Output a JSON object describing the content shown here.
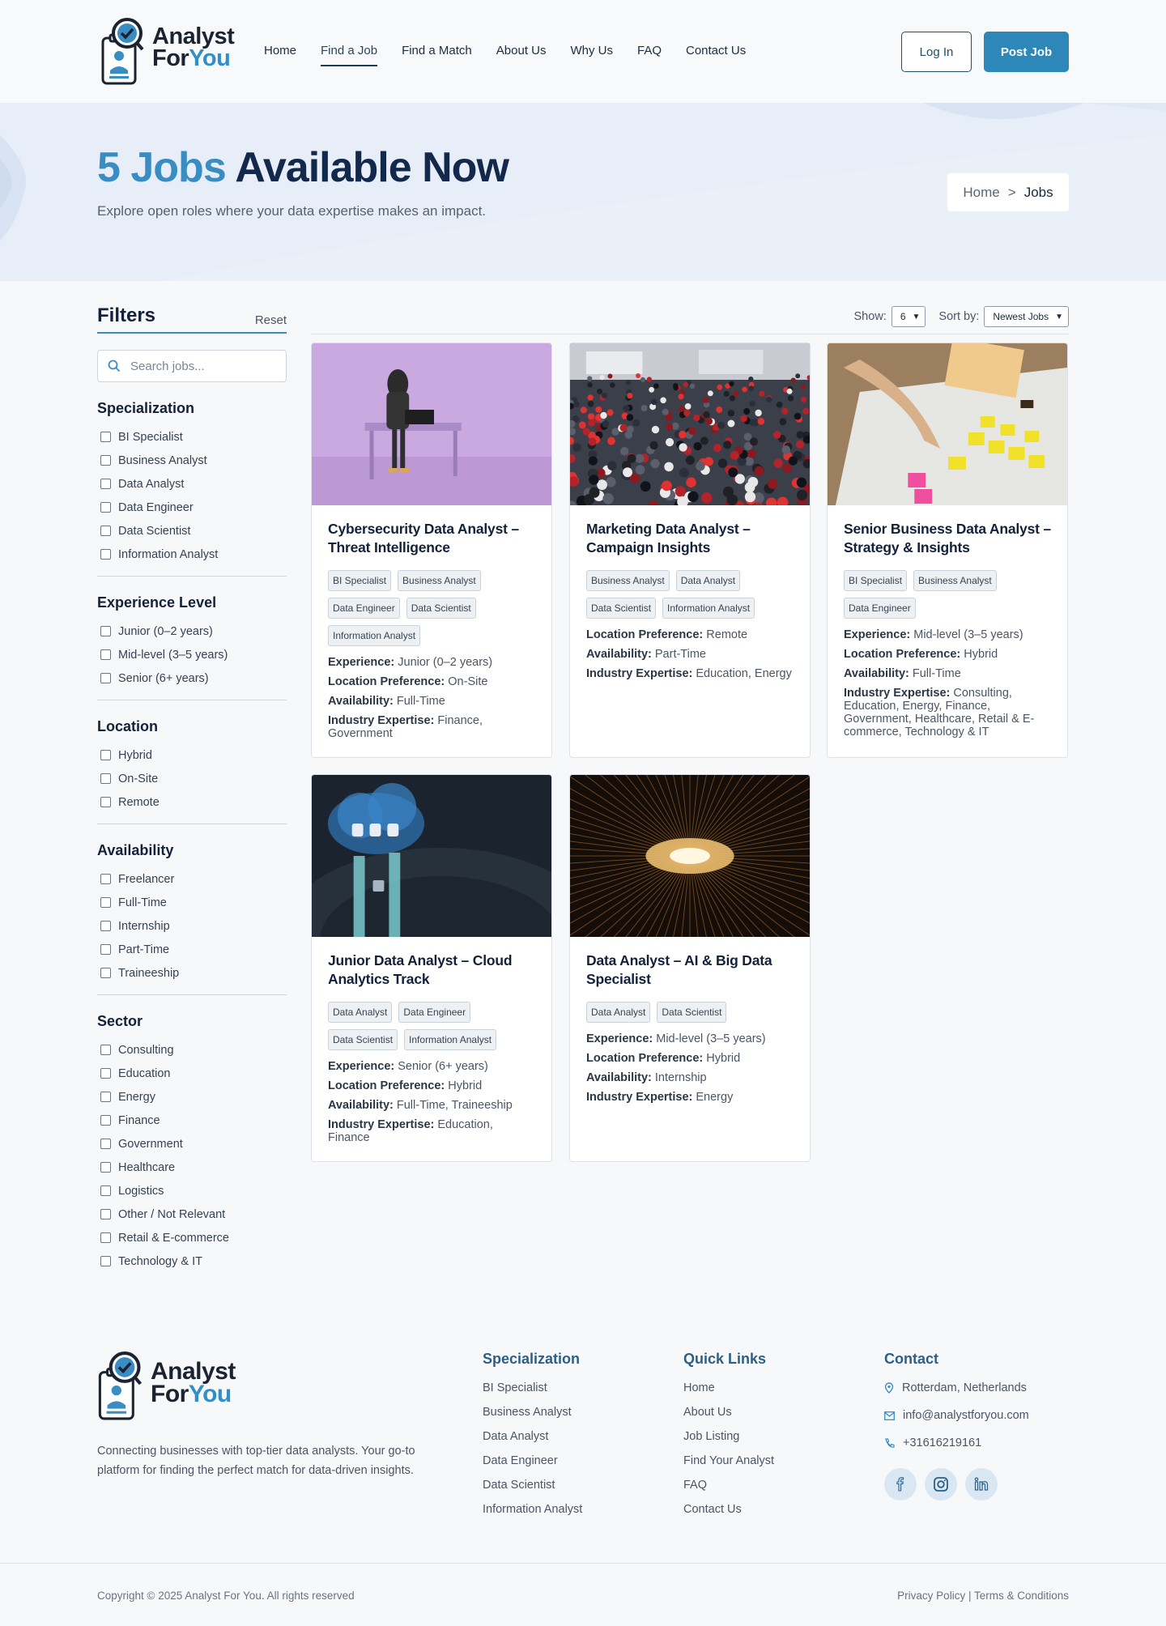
{
  "brand": {
    "name_top": "Analyst",
    "name_bottom_a": "For",
    "name_bottom_b": "You"
  },
  "nav": {
    "items": [
      "Home",
      "Find a Job",
      "Find a Match",
      "About Us",
      "Why Us",
      "FAQ",
      "Contact Us"
    ],
    "active": "Find a Job",
    "login": "Log In",
    "post_job": "Post Job"
  },
  "hero": {
    "title_count": "5 Jobs",
    "title_rest": "Available Now",
    "subtitle": "Explore open roles where your data expertise makes an impact.",
    "breadcrumb_home": "Home",
    "breadcrumb_sep": ">",
    "breadcrumb_current": "Jobs"
  },
  "filters": {
    "title": "Filters",
    "reset": "Reset",
    "search_placeholder": "Search jobs...",
    "sections": [
      {
        "title": "Specialization",
        "options": [
          "BI Specialist",
          "Business Analyst",
          "Data Analyst",
          "Data Engineer",
          "Data Scientist",
          "Information Analyst"
        ]
      },
      {
        "title": "Experience Level",
        "options": [
          "Junior (0–2 years)",
          "Mid-level (3–5 years)",
          "Senior (6+ years)"
        ]
      },
      {
        "title": "Location",
        "options": [
          "Hybrid",
          "On-Site",
          "Remote"
        ]
      },
      {
        "title": "Availability",
        "options": [
          "Freelancer",
          "Full-Time",
          "Internship",
          "Part-Time",
          "Traineeship"
        ]
      },
      {
        "title": "Sector",
        "options": [
          "Consulting",
          "Education",
          "Energy",
          "Finance",
          "Government",
          "Healthcare",
          "Logistics",
          "Other / Not Relevant",
          "Retail & E-commerce",
          "Technology & IT"
        ]
      }
    ]
  },
  "toolbar": {
    "show_label": "Show:",
    "show_value": "6",
    "sort_label": "Sort by:",
    "sort_value": "Newest Jobs"
  },
  "labels": {
    "experience": "Experience:",
    "location": "Location Preference:",
    "availability": "Availability:",
    "industry": "Industry Expertise:"
  },
  "jobs": [
    {
      "title": "Cybersecurity Data Analyst – Threat Intelligence",
      "image": "hooded-figure-laptop",
      "tags": [
        "BI Specialist",
        "Business Analyst",
        "Data Engineer",
        "Data Scientist",
        "Information Analyst"
      ],
      "experience": "Junior (0–2 years)",
      "location": "On-Site",
      "availability": "Full-Time",
      "industry": "Finance, Government"
    },
    {
      "title": "Marketing Data Analyst – Campaign Insights",
      "image": "crowd",
      "tags": [
        "Business Analyst",
        "Data Analyst",
        "Data Scientist",
        "Information Analyst"
      ],
      "experience": "",
      "location": "Remote",
      "availability": "Part-Time",
      "industry": "Education, Energy"
    },
    {
      "title": "Senior Business Data Analyst – Strategy & Insights",
      "image": "sticky-notes-planning",
      "tags": [
        "BI Specialist",
        "Business Analyst",
        "Data Engineer"
      ],
      "experience": "Mid-level (3–5 years)",
      "location": "Hybrid",
      "availability": "Full-Time",
      "industry": "Consulting, Education, Energy, Finance, Government, Healthcare, Retail & E-commerce, Technology & IT"
    },
    {
      "title": "Junior Data Analyst – Cloud Analytics Track",
      "image": "cloud-database",
      "tags": [
        "Data Analyst",
        "Data Engineer",
        "Data Scientist",
        "Information Analyst"
      ],
      "experience": "Senior (6+ years)",
      "location": "Hybrid",
      "availability": "Full-Time, Traineeship",
      "industry": "Education, Finance"
    },
    {
      "title": "Data Analyst – AI & Big Data Specialist",
      "image": "light-tunnel",
      "tags": [
        "Data Analyst",
        "Data Scientist"
      ],
      "experience": "Mid-level (3–5 years)",
      "location": "Hybrid",
      "availability": "Internship",
      "industry": "Energy"
    }
  ],
  "footer": {
    "description": "Connecting businesses with top-tier data analysts. Your go-to platform for finding the perfect match for data-driven insights.",
    "specialization_title": "Specialization",
    "specialization_links": [
      "BI Specialist",
      "Business Analyst",
      "Data Analyst",
      "Data Engineer",
      "Data Scientist",
      "Information Analyst"
    ],
    "quick_title": "Quick Links",
    "quick_links": [
      "Home",
      "About Us",
      "Job Listing",
      "Find Your Analyst",
      "FAQ",
      "Contact Us"
    ],
    "contact_title": "Contact",
    "address": "Rotterdam, Netherlands",
    "email": "info@analystforyou.com",
    "phone": "+31616219161",
    "socials": [
      "facebook-icon",
      "instagram-icon",
      "linkedin-icon"
    ],
    "copyright": "Copyright © 2025 Analyst For You. All rights reserved",
    "legal": "Privacy Policy | Terms & Conditions"
  },
  "colors": {
    "accent": "#2e87b9",
    "navy": "#13294b",
    "hero_bg": "#e7eef8"
  }
}
